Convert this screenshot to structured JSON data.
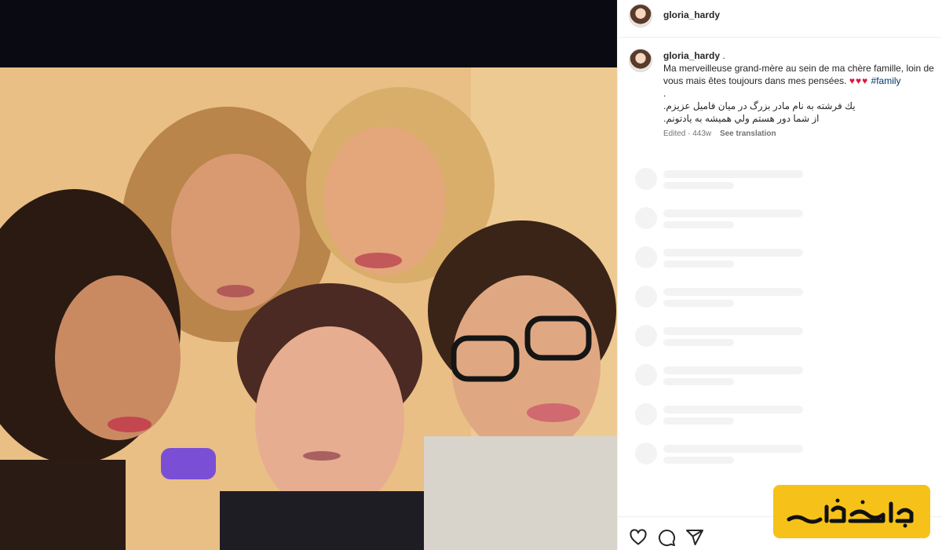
{
  "post": {
    "username": "gloria_hardy",
    "caption_username": "gloria_hardy",
    "caption_sep": ".",
    "caption_line1": "Ma merveilleuse grand-mère au sein de ma chère famille, loin de",
    "caption_line2": "vous mais êtes toujours dans mes pensées.",
    "hearts": "♥♥♥",
    "hashtag": "#family",
    "dot_line": ".",
    "persian_line1": "يك فرشته به نام مادر بزرگ در ميان فاميل عزيزم.",
    "persian_line2": "از شما دور هستم ولي هميشه به يادتونم.",
    "edited": "Edited · 443w",
    "see_translation": "See translation"
  },
  "icons": {
    "like": "heart-outline-icon",
    "comment": "comment-bubble-icon",
    "share": "paper-plane-icon"
  },
  "watermark": {
    "text": "ساعدنیوز",
    "color": "#f6c21a"
  },
  "colors": {
    "hashtag": "#00376b",
    "heart": "#e0163b",
    "skeleton": "#f3f3f3"
  }
}
